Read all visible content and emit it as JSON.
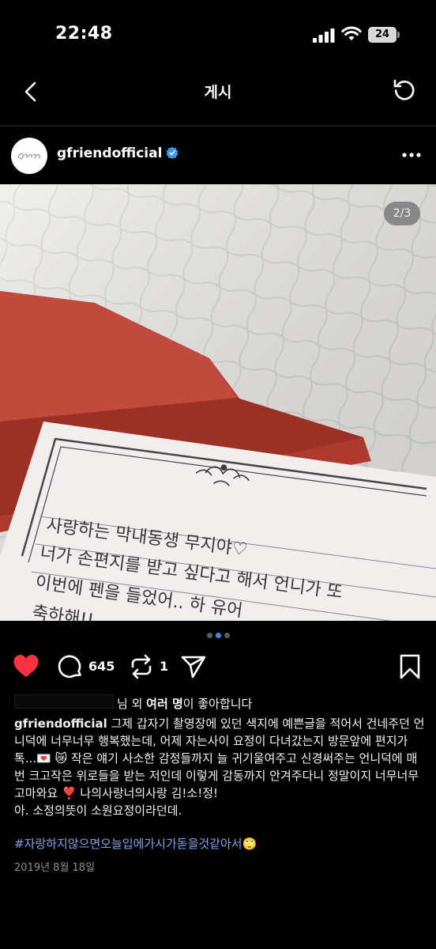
{
  "status_bar": {
    "time": "22:48",
    "battery": "24"
  },
  "nav": {
    "title": "게시",
    "back_icon": "chevron-left-icon",
    "refresh_icon": "refresh-icon"
  },
  "post": {
    "username": "gfriendofficial",
    "verified": true,
    "more_icon": "ellipsis-icon",
    "image_counter": "2/3",
    "carousel_active_index": 1,
    "carousel_count": 3,
    "letter": {
      "lines": [
        "사랑하는  막내동생  무지야♡",
        "너가  손편지를  받고  싶다고  해서  언니가  또",
        "이번에  펜을  들었어..  하  유어",
        "축하해!!  ..."
      ]
    }
  },
  "actions": {
    "like_count_hidden": "",
    "comment_count": "645",
    "repost_count": "1",
    "liked": true
  },
  "likes": {
    "suffix_pre": "님 외 ",
    "suffix_bold": "여러 명",
    "suffix_post": "이 좋아합니다"
  },
  "caption": {
    "username": "gfriendofficial",
    "text": " 그제 갑자기 촬영장에 있던 색지에 예쁜글을 적어서 건네주던 언니덕에 너무너무 행복했는데, 어제 자는사이 요정이 다녀갔는지 방문앞에 편지가 톡...💌 😿  작은 얘기 사소한 감정들까지 늘 귀기울여주고 신경써주는 언니덕에 매번 크고작은 위로들을 받는 저인데 이렇게 감동까지 안겨주다니 정말이지 너무너무 고마와요 ❣️ 나의사랑너의사랑 김!소!정!",
    "second_line": "아. 소정의뜻이 소원요정이라던데.",
    "hashtag": "#자랑하지않으면오늘입에가시가돋을것같아서🙄",
    "date": "2019년 8월 18일"
  },
  "colors": {
    "like_red": "#ff3040",
    "verified_blue": "#3897f0",
    "hashtag_blue": "#7ba6e8",
    "card_red": "#b23a2c"
  }
}
